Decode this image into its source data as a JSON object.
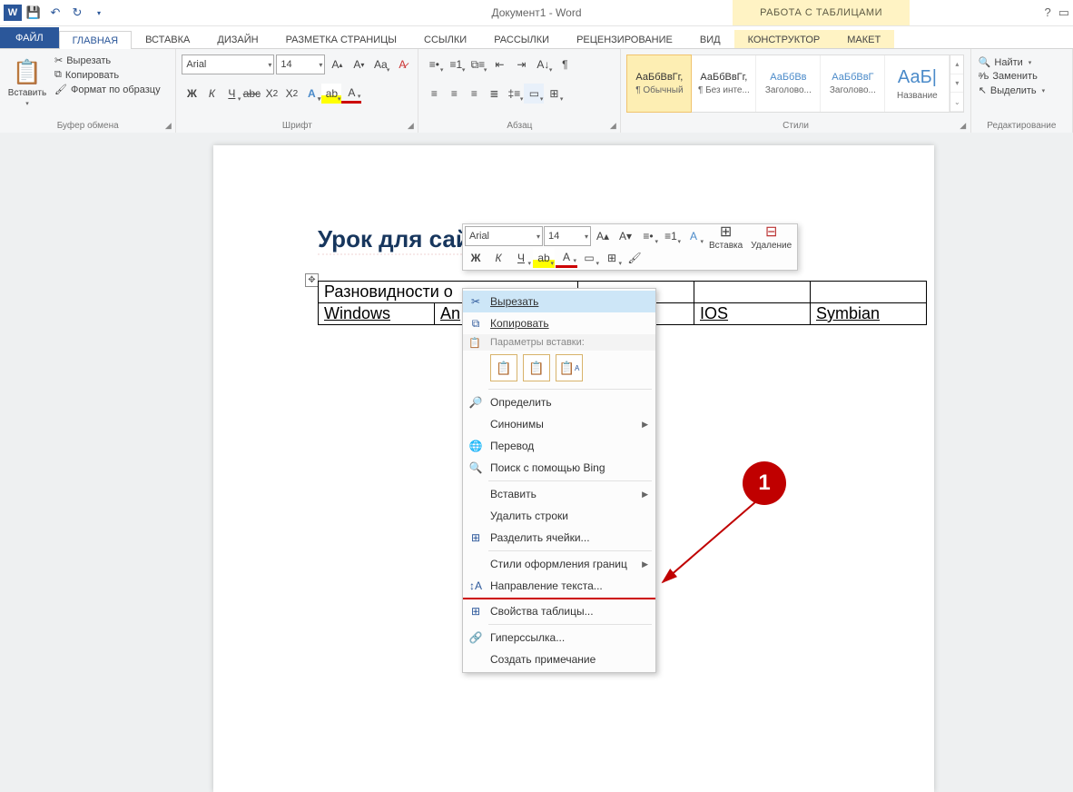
{
  "app": {
    "title": "Документ1 - Word",
    "table_tools": "РАБОТА С ТАБЛИЦАМИ"
  },
  "tabs": {
    "file": "ФАЙЛ",
    "home": "ГЛАВНАЯ",
    "insert": "ВСТАВКА",
    "design": "ДИЗАЙН",
    "layout": "РАЗМЕТКА СТРАНИЦЫ",
    "references": "ССЫЛКИ",
    "mailings": "РАССЫЛКИ",
    "review": "РЕЦЕНЗИРОВАНИЕ",
    "view": "ВИД",
    "tt_design": "КОНСТРУКТОР",
    "tt_layout": "МАКЕТ"
  },
  "ribbon": {
    "clipboard": {
      "label": "Буфер обмена",
      "paste": "Вставить",
      "cut": "Вырезать",
      "copy": "Копировать",
      "format_painter": "Формат по образцу"
    },
    "font": {
      "label": "Шрифт",
      "name": "Arial",
      "size": "14"
    },
    "paragraph": {
      "label": "Абзац"
    },
    "styles": {
      "label": "Стили",
      "items": [
        {
          "preview": "АаБбВвГг,",
          "name": "¶ Обычный"
        },
        {
          "preview": "АаБбВвГг,",
          "name": "¶ Без инте..."
        },
        {
          "preview": "АаБбВв",
          "name": "Заголово..."
        },
        {
          "preview": "АаБбВвГ",
          "name": "Заголово..."
        },
        {
          "preview": "АаБ|",
          "name": "Название"
        }
      ]
    },
    "editing": {
      "label": "Редактирование",
      "find": "Найти",
      "replace": "Заменить",
      "select": "Выделить"
    }
  },
  "mini": {
    "font": "Arial",
    "size": "14",
    "insert": "Вставка",
    "delete": "Удаление"
  },
  "context": {
    "cut": "Вырезать",
    "copy": "Копировать",
    "paste_head": "Параметры вставки:",
    "define": "Определить",
    "synonyms": "Синонимы",
    "translate": "Перевод",
    "bing": "Поиск с помощью Bing",
    "insert": "Вставить",
    "delete_rows": "Удалить строки",
    "split_cells": "Разделить ячейки...",
    "border_styles": "Стили оформления границ",
    "text_direction": "Направление текста...",
    "table_props": "Свойства таблицы...",
    "hyperlink": "Гиперссылка...",
    "new_comment": "Создать примечание"
  },
  "doc": {
    "heading": "Урок для сайт",
    "table": {
      "r1": "Разновидности о",
      "r2": [
        "Windows",
        "An",
        "IOS",
        "Symbian"
      ]
    }
  },
  "callout": {
    "num": "1"
  }
}
